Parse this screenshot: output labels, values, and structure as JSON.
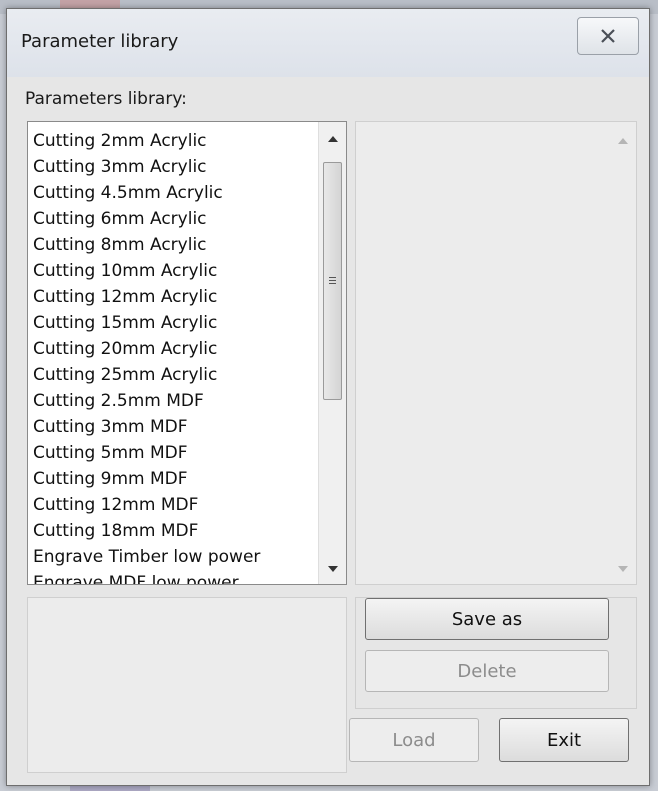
{
  "dialog": {
    "title": "Parameter library",
    "close_glyph": "close-icon"
  },
  "library": {
    "label": "Parameters library:",
    "items": [
      "Cutting 2mm Acrylic",
      "Cutting 3mm Acrylic",
      "Cutting 4.5mm Acrylic",
      "Cutting 6mm Acrylic",
      "Cutting 8mm Acrylic",
      "Cutting 10mm Acrylic",
      "Cutting 12mm Acrylic",
      "Cutting 15mm Acrylic",
      "Cutting 20mm Acrylic",
      "Cutting 25mm Acrylic",
      "Cutting 2.5mm MDF",
      "Cutting 3mm MDF",
      "Cutting 5mm MDF",
      "Cutting 9mm MDF",
      "Cutting 12mm MDF",
      "Cutting 18mm MDF",
      "Engrave Timber low power",
      "Engrave MDF low power"
    ]
  },
  "buttons": {
    "save_as": "Save as",
    "delete": "Delete",
    "load": "Load",
    "exit": "Exit"
  }
}
